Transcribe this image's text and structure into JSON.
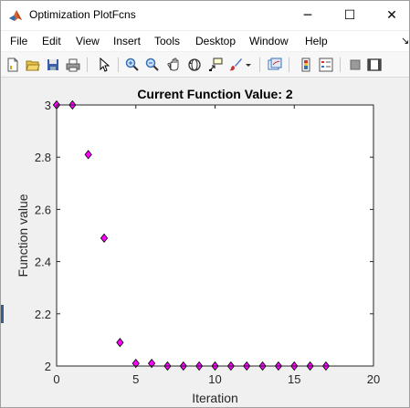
{
  "window": {
    "title": "Optimization PlotFcns",
    "minimize_glyph": "─",
    "maximize_glyph": "☐",
    "close_glyph": "✕",
    "app_icon": "matlab-icon"
  },
  "menu": {
    "items": [
      "File",
      "Edit",
      "View",
      "Insert",
      "Tools",
      "Desktop",
      "Window",
      "Help"
    ],
    "overflow_glyph": "↘"
  },
  "toolbar": {
    "icons": [
      "new-figure-icon",
      "open-file-icon",
      "save-icon",
      "print-icon",
      "pointer-icon",
      "zoom-in-icon",
      "zoom-out-icon",
      "pan-icon",
      "rotate-3d-icon",
      "data-cursor-icon",
      "brush-icon",
      "link-plot-icon",
      "colorbar-icon",
      "legend-icon",
      "hide-plot-tools-icon",
      "show-plot-tools-icon"
    ]
  },
  "chart_data": {
    "type": "scatter",
    "title": "Current Function Value: 2",
    "xlabel": "Iteration",
    "ylabel": "Function value",
    "xlim": [
      0,
      20
    ],
    "ylim": [
      2,
      3
    ],
    "xticks": [
      "0",
      "5",
      "10",
      "15",
      "20"
    ],
    "yticks": [
      "2",
      "2.2",
      "2.4",
      "2.6",
      "2.8",
      "3"
    ],
    "grid": false,
    "marker": "diamond",
    "marker_color": "#ff00ff",
    "marker_edge": "#000000",
    "series": [
      {
        "x": [
          0,
          1,
          2,
          3,
          4,
          5,
          6,
          7,
          8,
          9,
          10,
          11,
          12,
          13,
          14,
          15,
          16,
          17
        ],
        "values": [
          3,
          3,
          2.81,
          2.49,
          2.09,
          2.01,
          2.01,
          2.0,
          2.0,
          2.0,
          2.0,
          2.0,
          2.0,
          2.0,
          2.0,
          2.0,
          2.0,
          2.0
        ]
      }
    ]
  }
}
